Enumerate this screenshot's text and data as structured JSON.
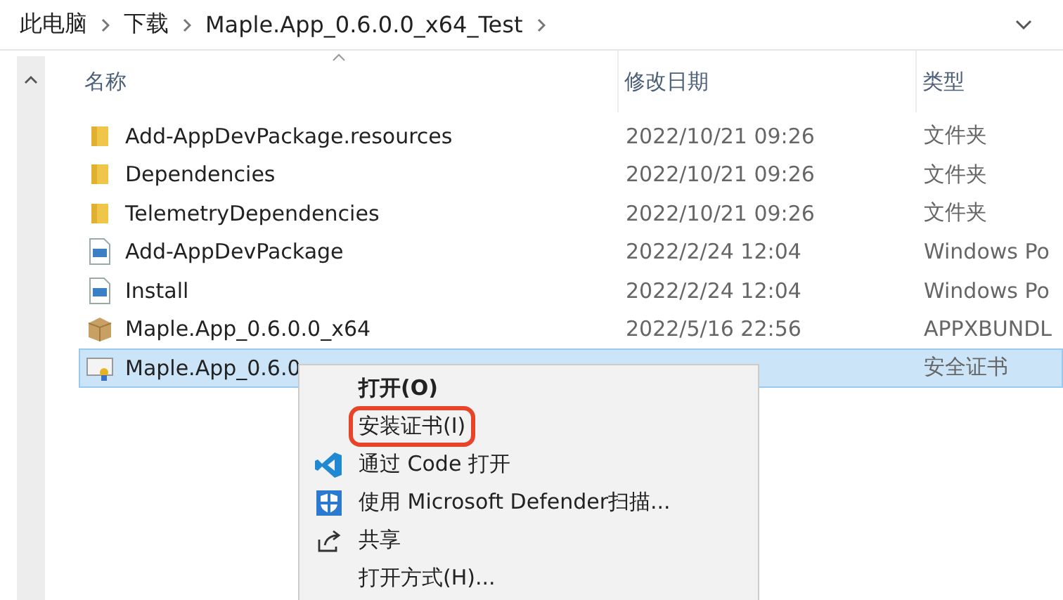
{
  "breadcrumb": [
    {
      "label": "此电脑"
    },
    {
      "label": "下载"
    },
    {
      "label": "Maple.App_0.6.0.0_x64_Test"
    }
  ],
  "columns": [
    {
      "label": "名称",
      "sorted": true
    },
    {
      "label": "修改日期",
      "sorted": false
    },
    {
      "label": "类型",
      "sorted": false
    }
  ],
  "rows": [
    {
      "kind": "folder",
      "name": "Add-AppDevPackage.resources",
      "date": "2022/10/21 09:26",
      "type": "文件夹",
      "selected": false
    },
    {
      "kind": "folder",
      "name": "Dependencies",
      "date": "2022/10/21 09:26",
      "type": "文件夹",
      "selected": false
    },
    {
      "kind": "folder",
      "name": "TelemetryDependencies",
      "date": "2022/10/21 09:26",
      "type": "文件夹",
      "selected": false
    },
    {
      "kind": "script",
      "name": "Add-AppDevPackage",
      "date": "2022/2/24 12:04",
      "type": "Windows Po",
      "selected": false
    },
    {
      "kind": "script",
      "name": "Install",
      "date": "2022/2/24 12:04",
      "type": "Windows Po",
      "selected": false
    },
    {
      "kind": "package",
      "name": "Maple.App_0.6.0.0_x64",
      "date": "2022/5/16 22:56",
      "type": "APPXBUNDL",
      "selected": false
    },
    {
      "kind": "certificate",
      "name": "Maple.App_0.6.0",
      "type": "安全证书",
      "selected": true
    }
  ],
  "context_menu": [
    {
      "kind": "plain",
      "label": "打开(O)",
      "default": true,
      "highlighted": false
    },
    {
      "kind": "plain",
      "label": "安装证书(I)",
      "default": false,
      "highlighted": true
    },
    {
      "kind": "code",
      "label": "通过 Code 打开",
      "default": false,
      "highlighted": false
    },
    {
      "kind": "shield",
      "label": "使用 Microsoft Defender扫描...",
      "default": false,
      "highlighted": false
    },
    {
      "kind": "share",
      "label": "共享",
      "default": false,
      "highlighted": false
    },
    {
      "kind": "plain",
      "label": "打开方式(H)...",
      "default": false,
      "highlighted": false
    }
  ]
}
